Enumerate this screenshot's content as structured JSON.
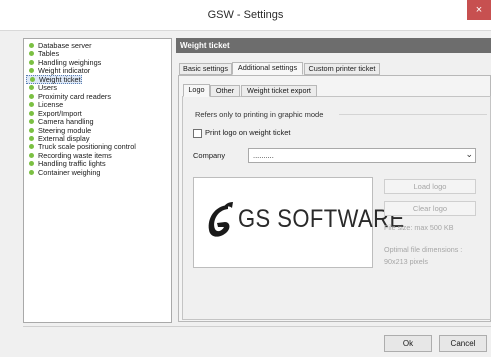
{
  "window": {
    "title": "GSW - Settings",
    "close_glyph": "×"
  },
  "sidebar": {
    "bullet_color": "#7bc043",
    "items": [
      {
        "label": "Database server"
      },
      {
        "label": "Tables"
      },
      {
        "label": "Handling weighings"
      },
      {
        "label": "Weight indicator"
      },
      {
        "label": "Weight ticket",
        "selected": true
      },
      {
        "label": "Users"
      },
      {
        "label": "Proximity card readers"
      },
      {
        "label": "License"
      },
      {
        "label": "Export/Import"
      },
      {
        "label": "Camera handling"
      },
      {
        "label": "Steering module"
      },
      {
        "label": "External display"
      },
      {
        "label": "Truck scale positioning control"
      },
      {
        "label": "Recording waste items"
      },
      {
        "label": "Handling traffic lights"
      },
      {
        "label": "Container weighing"
      }
    ]
  },
  "panel": {
    "title": "Weight ticket"
  },
  "tabs": [
    {
      "label": "Basic settings"
    },
    {
      "label": "Additional settings",
      "active": true
    },
    {
      "label": "Custom printer ticket"
    }
  ],
  "subtabs": [
    {
      "label": "Logo",
      "active": true
    },
    {
      "label": "Other"
    },
    {
      "label": "Weight ticket export"
    }
  ],
  "logo_group": {
    "legend": "Refers only to printing in graphic mode",
    "print_logo_label": "Print logo on weight ticket",
    "print_logo_checked": false,
    "company_label": "Company",
    "company_value": "..........",
    "logo_image_text": "GS SOFTWARE",
    "load_logo_label": "Load logo",
    "clear_logo_label": "Clear logo",
    "file_size_hint": "File size: max 500 KB",
    "dimensions_hint_line1": "Optimal file dimensions :",
    "dimensions_hint_line2": "90x213 pixels"
  },
  "footer": {
    "ok_label": "Ok",
    "cancel_label": "Cancel"
  }
}
